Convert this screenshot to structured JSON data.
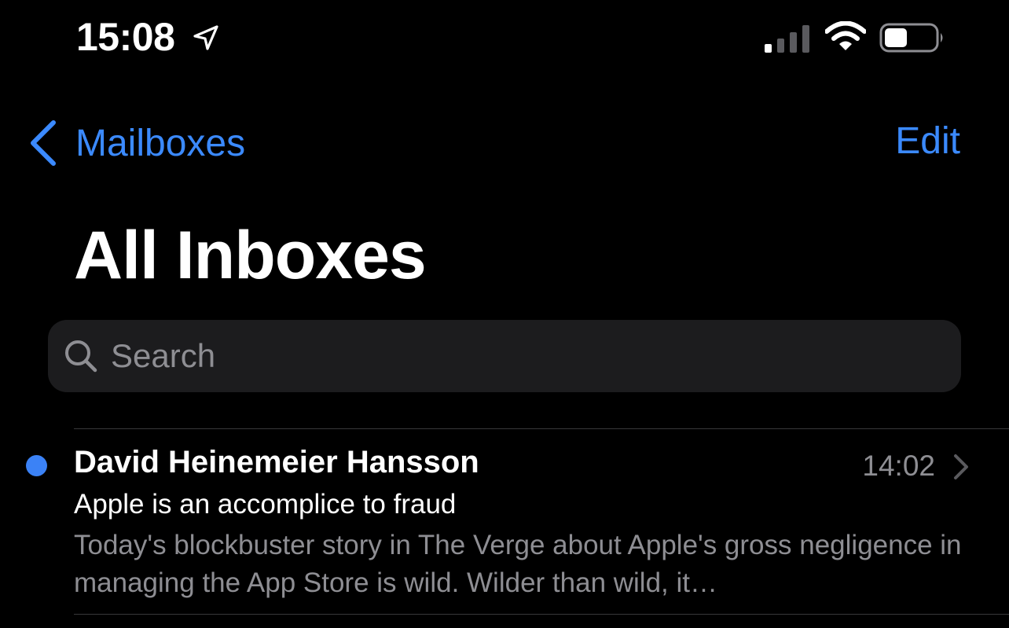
{
  "status_bar": {
    "time": "15:08",
    "icons": [
      "location-arrow-icon",
      "cellular-signal-icon",
      "wifi-icon",
      "battery-icon"
    ]
  },
  "nav": {
    "back_label": "Mailboxes",
    "edit_label": "Edit"
  },
  "title": "All Inboxes",
  "search": {
    "placeholder": "Search",
    "value": ""
  },
  "messages": [
    {
      "unread": true,
      "sender": "David Heinemeier Hansson",
      "time": "14:02",
      "subject": "Apple is an accomplice to fraud",
      "preview": "Today's blockbuster story in The Verge about Apple's gross negligence in managing the App Store is wild. Wilder than wild, it…"
    }
  ],
  "colors": {
    "accent": "#3b8aff",
    "unread_dot": "#3b82f6",
    "background": "#000000",
    "search_background": "#1c1c1e",
    "secondary_text": "#8e8e93",
    "separator": "#38383a"
  }
}
